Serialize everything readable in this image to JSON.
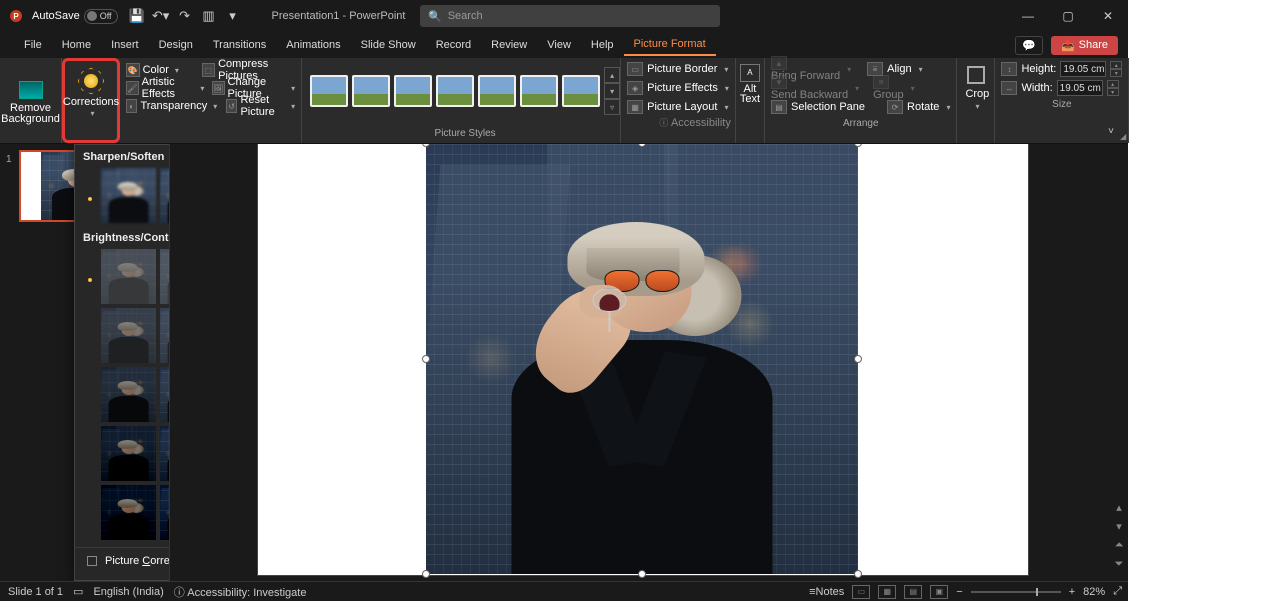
{
  "titlebar": {
    "autosave_label": "AutoSave",
    "autosave_state": "Off",
    "doc_title": "Presentation1  -  PowerPoint",
    "search_placeholder": "Search"
  },
  "tabs": [
    "File",
    "Home",
    "Insert",
    "Design",
    "Transitions",
    "Animations",
    "Slide Show",
    "Record",
    "Review",
    "View",
    "Help",
    "Picture Format"
  ],
  "active_tab": "Picture Format",
  "share_label": "Share",
  "ribbon": {
    "remove_bg": "Remove Background",
    "corrections": "Corrections",
    "adjust": {
      "color": "Color",
      "artistic": "Artistic Effects",
      "transparency": "Transparency",
      "compress": "Compress Pictures",
      "change": "Change Picture",
      "reset": "Reset Picture"
    },
    "styles_label": "Picture Styles",
    "pict": {
      "border": "Picture Border",
      "effects": "Picture Effects",
      "layout": "Picture Layout"
    },
    "alt_text": "Alt Text",
    "arrange": {
      "bring": "Bring Forward",
      "send": "Send Backward",
      "selection": "Selection Pane",
      "align": "Align",
      "group": "Group",
      "rotate": "Rotate",
      "label": "Arrange"
    },
    "crop": "Crop",
    "size": {
      "height_label": "Height:",
      "width_label": "Width:",
      "height_value": "19.05 cm",
      "width_value": "19.05 cm",
      "label": "Size"
    },
    "accessibility": "Accessibility"
  },
  "gallery": {
    "section1": "Sharpen/Soften",
    "section2": "Brightness/Contrast",
    "options": "Picture Corrections Options..."
  },
  "statusbar": {
    "slide": "Slide 1 of 1",
    "lang": "English (India)",
    "access": "Accessibility: Investigate",
    "notes": "Notes",
    "zoom": "82%"
  },
  "slide_number": "1"
}
